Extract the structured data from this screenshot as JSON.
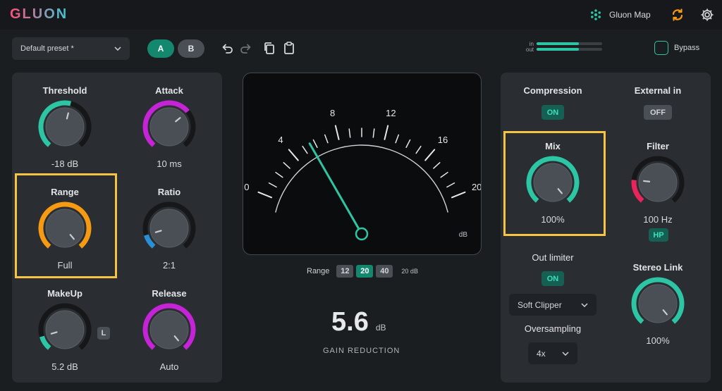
{
  "app": {
    "logo": "GLUON",
    "gluon_map": "Gluon Map"
  },
  "toolbar": {
    "preset": "Default preset *",
    "a_label": "A",
    "b_label": "B",
    "meter_in_label": "in",
    "meter_out_label": "out",
    "meter_in_level": 0.65,
    "meter_out_level": 0.65,
    "bypass_label": "Bypass"
  },
  "knobs": {
    "threshold": {
      "label": "Threshold",
      "value": "-18 dB",
      "level": 0.55,
      "color": "#2dc5a3"
    },
    "attack": {
      "label": "Attack",
      "value": "10 ms",
      "level": 0.68,
      "color": "#c424d6"
    },
    "range": {
      "label": "Range",
      "value": "Full",
      "level": 1.0,
      "color": "#f59a12"
    },
    "ratio": {
      "label": "Ratio",
      "value": "2:1",
      "level": 0.12,
      "color": "#2b8fd6"
    },
    "makeup": {
      "label": "MakeUp",
      "value": "5.2 dB",
      "level": 0.12,
      "color": "#2dc5a3",
      "badge": "L"
    },
    "release": {
      "label": "Release",
      "value": "Auto",
      "level": 1.0,
      "color": "#c424d6"
    },
    "mix": {
      "label": "Mix",
      "value": "100%",
      "level": 1.0,
      "color": "#2dc5a3"
    },
    "filter": {
      "label": "Filter",
      "value": "100 Hz",
      "level": 0.2,
      "color": "#e8255a",
      "badge": "HP"
    },
    "stereo_link": {
      "label": "Stereo Link",
      "value": "100%",
      "level": 1.0,
      "color": "#2dc5a3"
    }
  },
  "meter": {
    "scale_labels": [
      "0",
      "4",
      "8",
      "12",
      "16",
      "20"
    ],
    "unit": "dB",
    "needle_db": 5.6,
    "range_label": "Range",
    "range_options": [
      "12",
      "20",
      "40"
    ],
    "range_selected": "20",
    "range_suffix": "20 dB",
    "gain_value": "5.6",
    "gain_unit": "dB",
    "gain_label": "GAIN REDUCTION"
  },
  "right": {
    "compression_label": "Compression",
    "compression_state": "ON",
    "external_label": "External in",
    "external_state": "OFF",
    "out_limiter_label": "Out limiter",
    "out_limiter_state": "ON",
    "limiter_mode": "Soft Clipper",
    "oversampling_label": "Oversampling",
    "oversampling_value": "4x"
  },
  "colors": {
    "accent": "#2dc5a3",
    "highlight": "#f5c443",
    "background": "#1b1e21",
    "panel": "#2a2e32"
  }
}
